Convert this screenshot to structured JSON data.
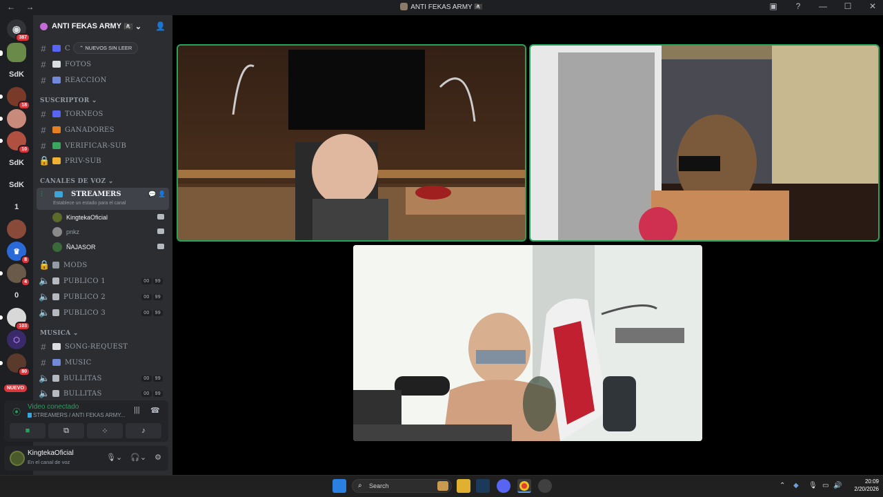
{
  "window": {
    "title": "ANTI FEKAS ARMY 🏴‍☠️",
    "nav_arrows": "← →",
    "controls": {
      "minimize": "—",
      "maximize": "☐",
      "close": "✕"
    }
  },
  "server_rail": {
    "servers": [
      {
        "label": "",
        "badge": "387"
      },
      {
        "label": "",
        "badge": ""
      },
      {
        "label": "SdK",
        "badge": ""
      },
      {
        "label": "",
        "badge": "18"
      },
      {
        "label": "",
        "badge": ""
      },
      {
        "label": "",
        "badge": "10"
      },
      {
        "label": "SdK",
        "badge": ""
      },
      {
        "label": "SdK",
        "badge": ""
      },
      {
        "label": "1",
        "badge": ""
      },
      {
        "label": "",
        "badge": ""
      },
      {
        "label": "",
        "badge": "8"
      },
      {
        "label": "",
        "badge": "4"
      },
      {
        "label": "0",
        "badge": ""
      },
      {
        "label": "",
        "badge": "103"
      },
      {
        "label": "",
        "badge": ""
      },
      {
        "label": "",
        "badge": "80"
      }
    ],
    "new_label": "NUEVO"
  },
  "guild": {
    "name": "ANTI FEKAS ARMY",
    "name_suffix": "🏴‍☠️",
    "unread_tooltip": "NUEVOS SIN LEER"
  },
  "channels": {
    "top": [
      {
        "name": "C",
        "icon_color": "#5865f2"
      },
      {
        "name": "FOTOS",
        "icon_color": "#dbdee1"
      },
      {
        "name": "REACCION",
        "icon_color": "#7289da"
      }
    ],
    "cat_suscriptor": "SUSCRIPTOR",
    "suscriptor": [
      {
        "name": "TORNEOS",
        "icon_color": "#5865f2"
      },
      {
        "name": "GANADORES",
        "icon_color": "#e67e22"
      },
      {
        "name": "VERIFICAR-SUB",
        "icon_color": "#3ba55d"
      },
      {
        "name": "PRIV-SUB",
        "icon_color": "#f0b232"
      }
    ],
    "cat_voz": "CANALES DE VOZ",
    "streamers": {
      "name": "STREAMERS",
      "status_hint": "Establece un estado para el canal",
      "members": [
        {
          "name": "KingtekaOficial",
          "color": "#5a6b2a"
        },
        {
          "name": "pnkz",
          "color": "#8a8a8a"
        },
        {
          "name": "ÑAJASOR",
          "color": "#3a6a3a"
        }
      ]
    },
    "mods": "MODS",
    "publicos": [
      {
        "name": "PUBLICO 1",
        "a": "00",
        "b": "99"
      },
      {
        "name": "PUBLICO 2",
        "a": "00",
        "b": "99"
      },
      {
        "name": "PUBLICO 3",
        "a": "00",
        "b": "99"
      }
    ],
    "cat_musica": "MUSICA",
    "musica": [
      {
        "name": "SONG-REQUEST"
      },
      {
        "name": "MUSIC"
      }
    ],
    "bullitas": [
      {
        "name": "BULLITAS",
        "a": "00",
        "b": "99"
      },
      {
        "name": "BULLITAS",
        "a": "00",
        "b": "99"
      }
    ]
  },
  "voice_panel": {
    "status": "Video conectado",
    "channel": "STREAMERS / ANTI FEKAS ARMY..."
  },
  "user_panel": {
    "username": "KingtekaOficial",
    "status": "En el canal de voz"
  },
  "taskbar": {
    "search_placeholder": "Search",
    "time": "20:09",
    "date": "2/20/2026"
  }
}
